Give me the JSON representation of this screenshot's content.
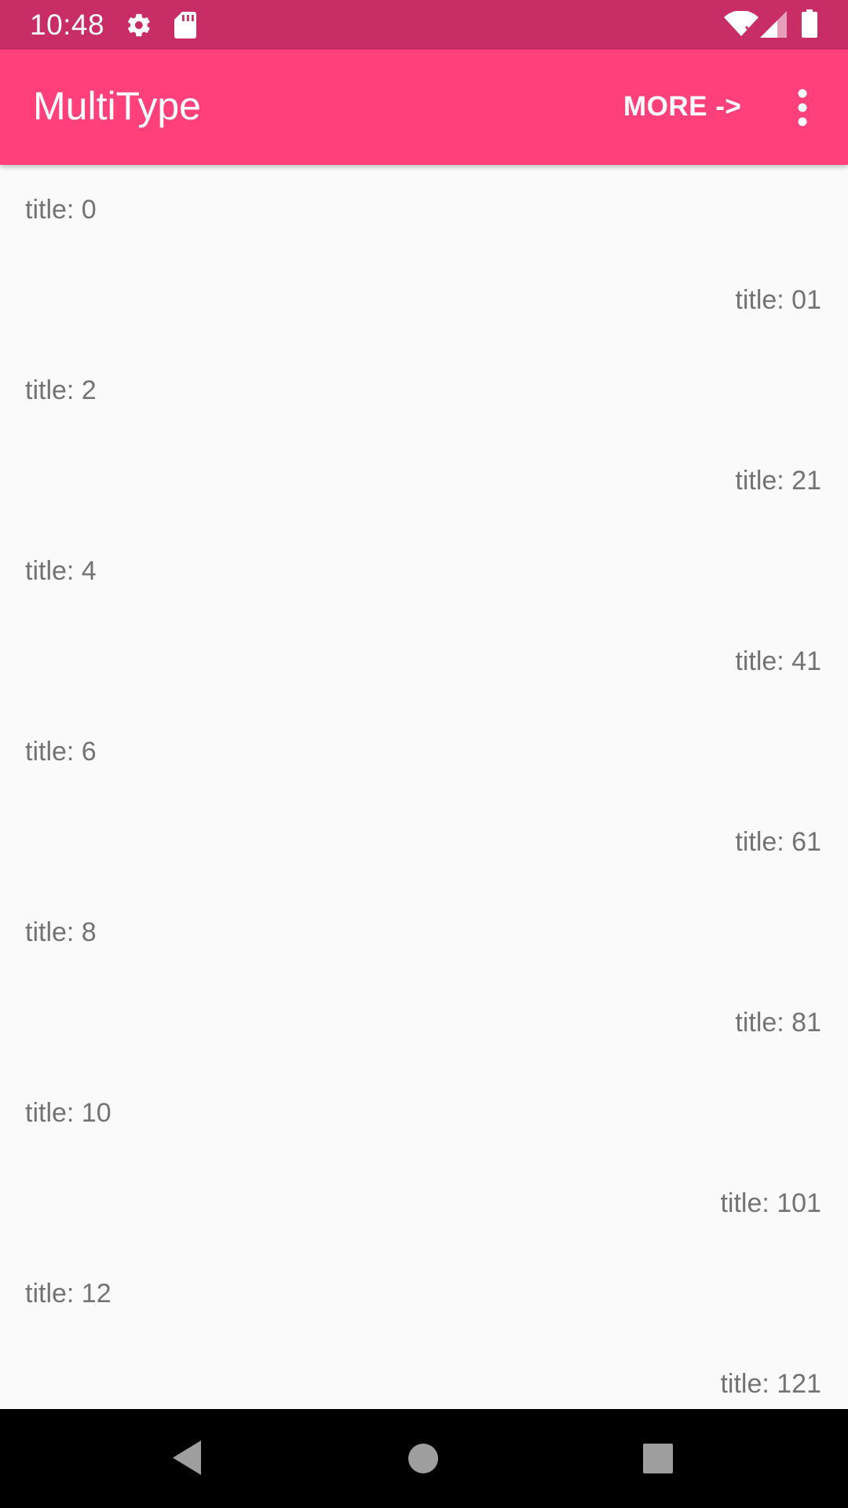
{
  "status_bar": {
    "time": "10:48",
    "icons": [
      "settings-icon",
      "sd-card-icon",
      "wifi-icon",
      "cell-signal-icon",
      "battery-icon"
    ]
  },
  "app_bar": {
    "title": "MultiType",
    "more_label": "MORE ->",
    "overflow_icon": "more-vert-icon"
  },
  "colors": {
    "status_bar": "#c92d66",
    "app_bar": "#ff407b",
    "background": "#fafafa",
    "item_text": "#737373"
  },
  "list": {
    "rows": [
      {
        "left": "title: 0",
        "right": "title: 01"
      },
      {
        "left": "title: 2",
        "right": "title: 21"
      },
      {
        "left": "title: 4",
        "right": "title: 41"
      },
      {
        "left": "title: 6",
        "right": "title: 61"
      },
      {
        "left": "title: 8",
        "right": "title: 81"
      },
      {
        "left": "title: 10",
        "right": "title: 101"
      },
      {
        "left": "title: 12",
        "right": "title: 121"
      }
    ]
  },
  "nav_bar": {
    "buttons": [
      "back-icon",
      "home-icon",
      "recents-icon"
    ]
  }
}
